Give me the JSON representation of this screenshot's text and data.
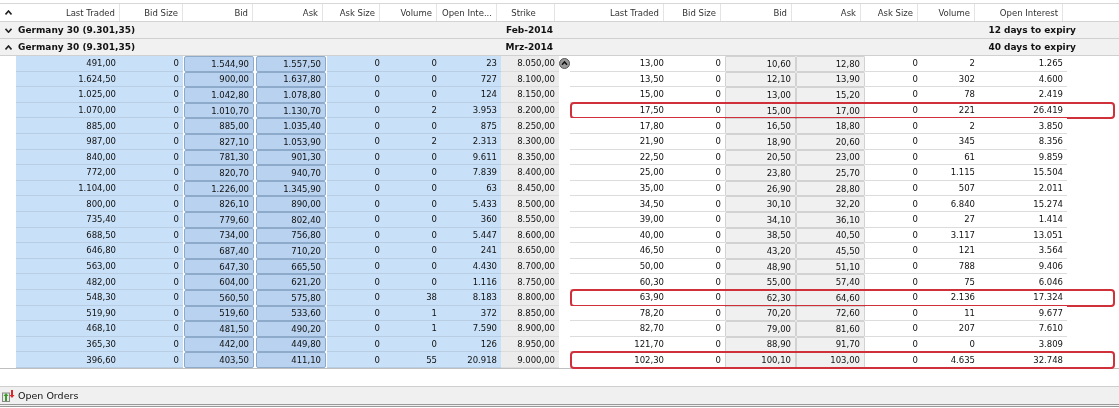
{
  "table": {
    "columns_calls": [
      "Last Traded",
      "Bid Size",
      "Bid",
      "Ask",
      "Ask Size",
      "Volume",
      "Open Inte..."
    ],
    "column_strike": "Strike",
    "columns_puts": [
      "Last Traded",
      "Bid Size",
      "Bid",
      "Ask",
      "Ask Size",
      "Volume",
      "Open Interest"
    ],
    "groups": [
      {
        "label": "Germany 30 (9.301,35)",
        "month": "Feb-2014",
        "expiry": "12 days to expiry",
        "expanded": false
      },
      {
        "label": "Germany 30 (9.301,35)",
        "month": "Mrz-2014",
        "expiry": "40 days to expiry",
        "expanded": true,
        "rows": [
          {
            "call": [
              "491,00",
              "0",
              "1.544,90",
              "1.557,50",
              "0",
              "0",
              "23"
            ],
            "strike": "8.050,00",
            "put": [
              "13,00",
              "0",
              "10,60",
              "12,80",
              "0",
              "2",
              "1.265"
            ],
            "call_in_money": true,
            "scroll_button": true,
            "highlighted": false
          },
          {
            "call": [
              "1.624,50",
              "0",
              "900,00",
              "1.637,80",
              "0",
              "0",
              "727"
            ],
            "strike": "8.100,00",
            "put": [
              "13,50",
              "0",
              "12,10",
              "13,90",
              "0",
              "302",
              "4.600"
            ],
            "call_in_money": true,
            "scroll_button": false,
            "highlighted": false
          },
          {
            "call": [
              "1.025,00",
              "0",
              "1.042,80",
              "1.078,80",
              "0",
              "0",
              "124"
            ],
            "strike": "8.150,00",
            "put": [
              "15,00",
              "0",
              "13,00",
              "15,20",
              "0",
              "78",
              "2.419"
            ],
            "call_in_money": true,
            "scroll_button": false,
            "highlighted": false
          },
          {
            "call": [
              "1.070,00",
              "0",
              "1.010,70",
              "1.130,70",
              "0",
              "2",
              "3.953"
            ],
            "strike": "8.200,00",
            "put": [
              "17,50",
              "0",
              "15,00",
              "17,00",
              "0",
              "221",
              "26.419"
            ],
            "call_in_money": true,
            "scroll_button": false,
            "highlighted": true
          },
          {
            "call": [
              "885,00",
              "0",
              "885,00",
              "1.035,40",
              "0",
              "0",
              "875"
            ],
            "strike": "8.250,00",
            "put": [
              "17,80",
              "0",
              "16,50",
              "18,80",
              "0",
              "2",
              "3.850"
            ],
            "call_in_money": true,
            "scroll_button": false,
            "highlighted": false
          },
          {
            "call": [
              "987,00",
              "0",
              "827,10",
              "1.053,90",
              "0",
              "2",
              "2.313"
            ],
            "strike": "8.300,00",
            "put": [
              "21,90",
              "0",
              "18,90",
              "20,60",
              "0",
              "345",
              "8.356"
            ],
            "call_in_money": true,
            "scroll_button": false,
            "highlighted": false
          },
          {
            "call": [
              "840,00",
              "0",
              "781,30",
              "901,30",
              "0",
              "0",
              "9.611"
            ],
            "strike": "8.350,00",
            "put": [
              "22,50",
              "0",
              "20,50",
              "23,00",
              "0",
              "61",
              "9.859"
            ],
            "call_in_money": true,
            "scroll_button": false,
            "highlighted": false
          },
          {
            "call": [
              "772,00",
              "0",
              "820,70",
              "940,70",
              "0",
              "0",
              "7.839"
            ],
            "strike": "8.400,00",
            "put": [
              "25,00",
              "0",
              "23,80",
              "25,70",
              "0",
              "1.115",
              "15.504"
            ],
            "call_in_money": true,
            "scroll_button": false,
            "highlighted": false
          },
          {
            "call": [
              "1.104,00",
              "0",
              "1.226,00",
              "1.345,90",
              "0",
              "0",
              "63"
            ],
            "strike": "8.450,00",
            "put": [
              "35,00",
              "0",
              "26,90",
              "28,80",
              "0",
              "507",
              "2.011"
            ],
            "call_in_money": true,
            "scroll_button": false,
            "highlighted": false
          },
          {
            "call": [
              "800,00",
              "0",
              "826,10",
              "890,00",
              "0",
              "0",
              "5.433"
            ],
            "strike": "8.500,00",
            "put": [
              "34,50",
              "0",
              "30,10",
              "32,20",
              "0",
              "6.840",
              "15.274"
            ],
            "call_in_money": true,
            "scroll_button": false,
            "highlighted": false
          },
          {
            "call": [
              "735,40",
              "0",
              "779,60",
              "802,40",
              "0",
              "0",
              "360"
            ],
            "strike": "8.550,00",
            "put": [
              "39,00",
              "0",
              "34,10",
              "36,10",
              "0",
              "27",
              "1.414"
            ],
            "call_in_money": true,
            "scroll_button": false,
            "highlighted": false
          },
          {
            "call": [
              "688,50",
              "0",
              "734,00",
              "756,80",
              "0",
              "0",
              "5.447"
            ],
            "strike": "8.600,00",
            "put": [
              "40,00",
              "0",
              "38,50",
              "40,50",
              "0",
              "3.117",
              "13.051"
            ],
            "call_in_money": true,
            "scroll_button": false,
            "highlighted": false
          },
          {
            "call": [
              "646,80",
              "0",
              "687,40",
              "710,20",
              "0",
              "0",
              "241"
            ],
            "strike": "8.650,00",
            "put": [
              "46,50",
              "0",
              "43,20",
              "45,50",
              "0",
              "121",
              "3.564"
            ],
            "call_in_money": true,
            "scroll_button": false,
            "highlighted": false
          },
          {
            "call": [
              "563,00",
              "0",
              "647,30",
              "665,50",
              "0",
              "0",
              "4.430"
            ],
            "strike": "8.700,00",
            "put": [
              "50,00",
              "0",
              "48,90",
              "51,10",
              "0",
              "788",
              "9.406"
            ],
            "call_in_money": true,
            "scroll_button": false,
            "highlighted": false
          },
          {
            "call": [
              "482,00",
              "0",
              "604,00",
              "621,20",
              "0",
              "0",
              "1.116"
            ],
            "strike": "8.750,00",
            "put": [
              "60,30",
              "0",
              "55,00",
              "57,40",
              "0",
              "75",
              "6.046"
            ],
            "call_in_money": true,
            "scroll_button": false,
            "highlighted": false
          },
          {
            "call": [
              "548,30",
              "0",
              "560,50",
              "575,80",
              "0",
              "38",
              "8.183"
            ],
            "strike": "8.800,00",
            "put": [
              "63,90",
              "0",
              "62,30",
              "64,60",
              "0",
              "2.136",
              "17.324"
            ],
            "call_in_money": true,
            "scroll_button": false,
            "highlighted": true
          },
          {
            "call": [
              "519,90",
              "0",
              "519,60",
              "533,60",
              "0",
              "1",
              "372"
            ],
            "strike": "8.850,00",
            "put": [
              "78,20",
              "0",
              "70,20",
              "72,60",
              "0",
              "11",
              "9.677"
            ],
            "call_in_money": true,
            "scroll_button": false,
            "highlighted": false
          },
          {
            "call": [
              "468,10",
              "0",
              "481,50",
              "490,20",
              "0",
              "1",
              "7.590"
            ],
            "strike": "8.900,00",
            "put": [
              "82,70",
              "0",
              "79,00",
              "81,60",
              "0",
              "207",
              "7.610"
            ],
            "call_in_money": true,
            "scroll_button": false,
            "highlighted": false
          },
          {
            "call": [
              "365,30",
              "0",
              "442,00",
              "449,80",
              "0",
              "0",
              "126"
            ],
            "strike": "8.950,00",
            "put": [
              "121,70",
              "0",
              "88,90",
              "91,70",
              "0",
              "0",
              "3.809"
            ],
            "call_in_money": true,
            "scroll_button": false,
            "highlighted": false
          },
          {
            "call": [
              "396,60",
              "0",
              "403,50",
              "411,10",
              "0",
              "55",
              "20.918"
            ],
            "strike": "9.000,00",
            "put": [
              "102,30",
              "0",
              "100,10",
              "103,00",
              "0",
              "4.635",
              "32.748"
            ],
            "call_in_money": true,
            "scroll_button": false,
            "highlighted": true
          }
        ]
      }
    ]
  },
  "bottom_tab": {
    "label": "Open Orders"
  }
}
